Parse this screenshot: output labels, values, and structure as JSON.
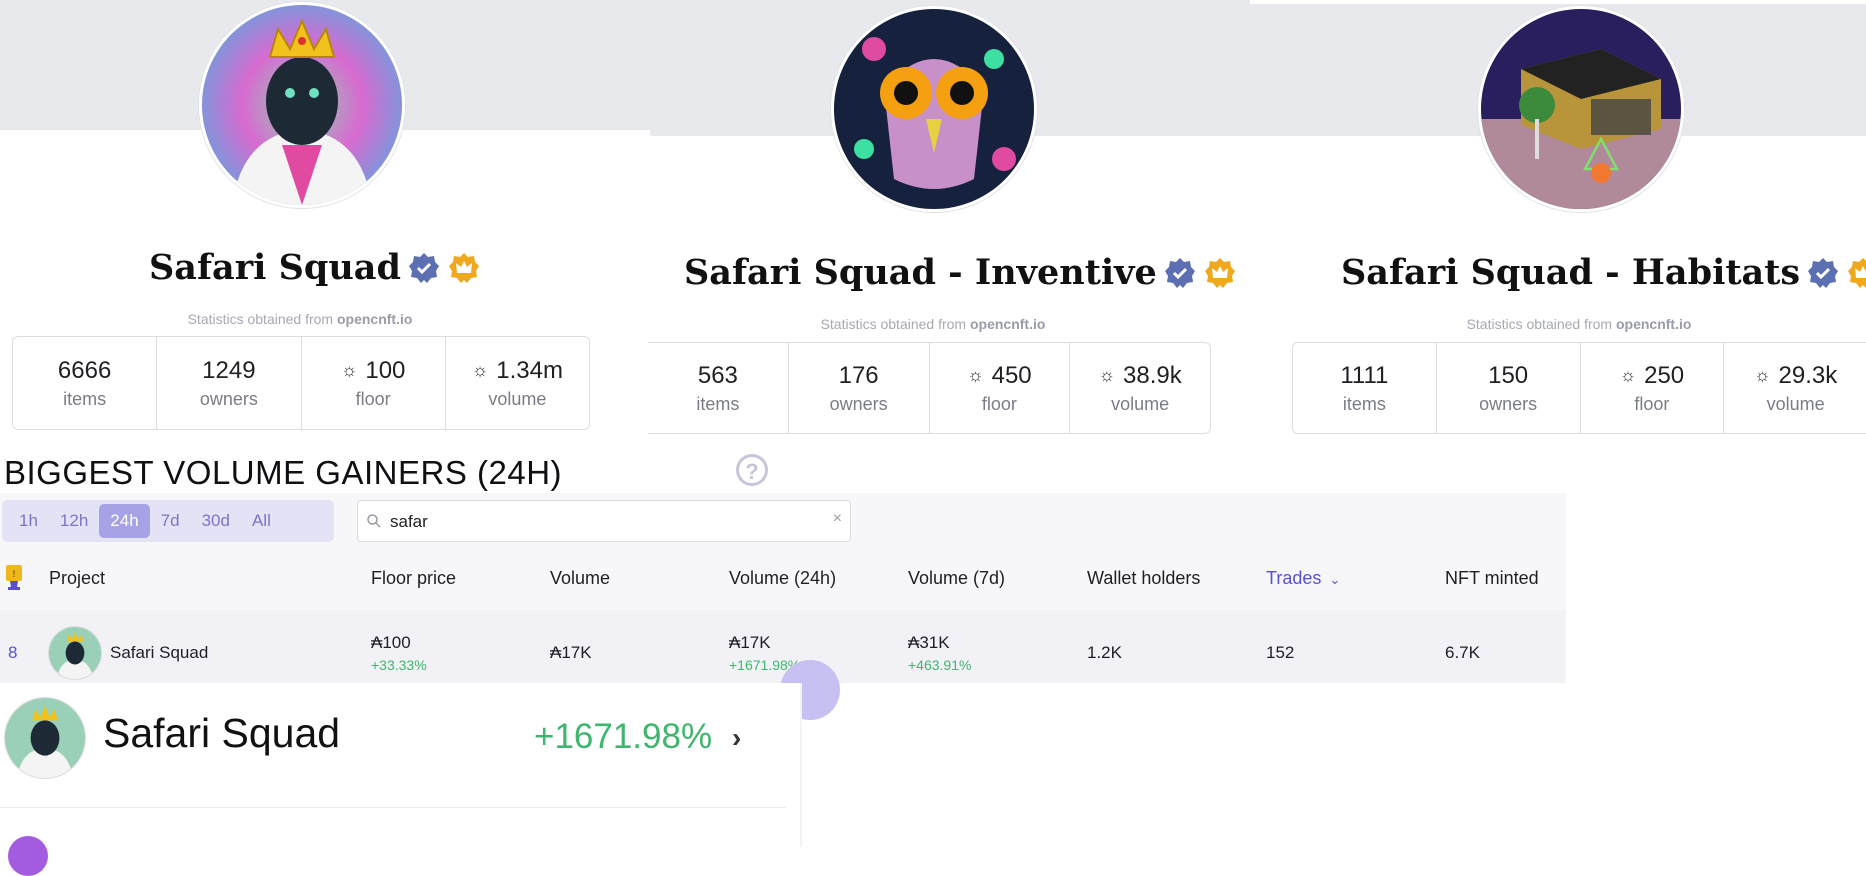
{
  "collections": [
    {
      "name": "Safari Squad",
      "source_prefix": "Statistics obtained from",
      "source_site": "opencnft.io",
      "stats": [
        {
          "value": "6666",
          "label": "items"
        },
        {
          "value": "1249",
          "label": "owners"
        },
        {
          "value": "100",
          "label": "floor"
        },
        {
          "value": "1.34m",
          "label": "volume"
        }
      ]
    },
    {
      "name": "Safari Squad - Inventive",
      "source_prefix": "Statistics obtained from",
      "source_site": "opencnft.io",
      "stats": [
        {
          "value": "563",
          "label": "items"
        },
        {
          "value": "176",
          "label": "owners"
        },
        {
          "value": "450",
          "label": "floor"
        },
        {
          "value": "38.9k",
          "label": "volume"
        }
      ]
    },
    {
      "name": "Safari Squad - Habitats",
      "source_prefix": "Statistics obtained from",
      "source_site": "opencnft.io",
      "stats": [
        {
          "value": "1111",
          "label": "items"
        },
        {
          "value": "150",
          "label": "owners"
        },
        {
          "value": "250",
          "label": "floor"
        },
        {
          "value": "29.3k",
          "label": "volume"
        }
      ]
    }
  ],
  "gainers": {
    "title": "BIGGEST VOLUME GAINERS (24H)",
    "help_glyph": "?",
    "ranges": [
      "1h",
      "12h",
      "24h",
      "7d",
      "30d",
      "All"
    ],
    "active_range": "24h",
    "search_value": "safar",
    "clear_glyph": "×",
    "columns": [
      "Project",
      "Floor price",
      "Volume",
      "Volume (24h)",
      "Volume (7d)",
      "Wallet holders",
      "Trades",
      "NFT minted"
    ],
    "sorted_column": "Trades",
    "row": {
      "rank": "8",
      "project": "Safari Squad",
      "floor_price": "₳100",
      "floor_delta": "+33.33%",
      "volume": "₳17K",
      "volume_24h": "₳17K",
      "volume_24h_delta": "+1671.98%",
      "volume_7d": "₳31K",
      "volume_7d_delta": "+463.91%",
      "wallet_holders": "1.2K",
      "trades": "152",
      "nft_minted": "6.7K"
    },
    "top_card": {
      "name": "Safari Squad",
      "change": "+1671.98%",
      "chevron": "›"
    }
  },
  "colors": {
    "accent": "#5b4fd1",
    "positive": "#3fb56d",
    "verified_badge": "#5c6fb3",
    "crown_badge": "#f0a81c"
  },
  "icons": [
    "verified-badge-icon",
    "crown-badge-icon",
    "cardano-icon",
    "help-icon",
    "search-icon",
    "close-icon",
    "trophy-icon",
    "chevron-down-icon",
    "chevron-right-icon"
  ]
}
